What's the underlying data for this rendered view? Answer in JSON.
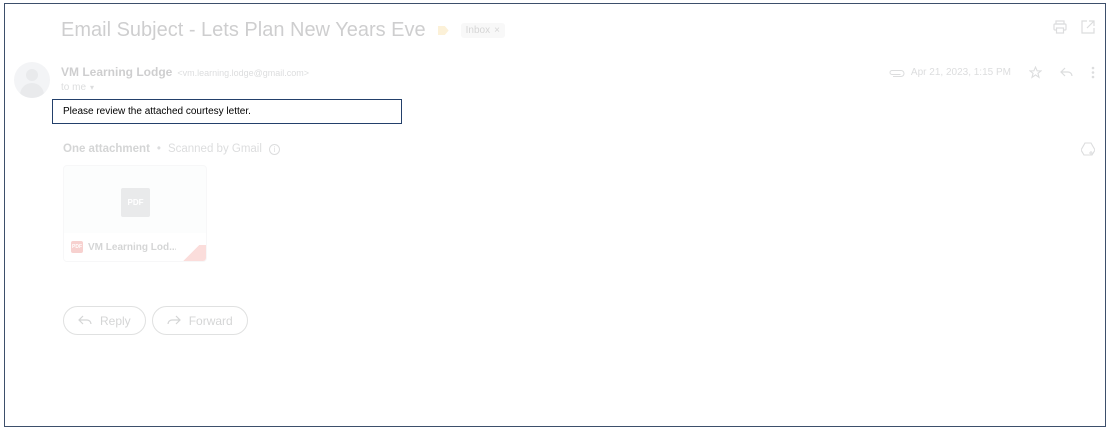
{
  "email": {
    "subject": "Email Subject - Lets Plan New Years Eve",
    "label_chip": "Inbox",
    "label_chip_close": "×",
    "sender_name": "VM Learning Lodge",
    "sender_email": "<vm.learning.lodge@gmail.com>",
    "to_line": "to me",
    "to_caret": "▾",
    "date": "Apr 21, 2023, 1:15 PM",
    "body": "Please review the attached courtesy letter."
  },
  "attachments": {
    "title": "One attachment",
    "separator": "•",
    "scanned_text": "Scanned by Gmail",
    "info_glyph": "i",
    "items": [
      {
        "big_icon_text": "PDF",
        "small_icon_text": "PDF",
        "file_name": "VM Learning Lod..."
      }
    ]
  },
  "actions": {
    "reply_label": "Reply",
    "forward_label": "Forward"
  },
  "colors": {
    "callout_border": "#23406b",
    "label_marker": "#f2c14e",
    "pdf_red": "#d93025"
  },
  "icons": [
    "print-icon",
    "open-in-new-window-icon",
    "label-icon",
    "attachment-clip-icon",
    "star-icon",
    "reply-icon",
    "more-vert-icon",
    "add-to-drive-icon",
    "info-icon",
    "pdf-icon",
    "forward-icon"
  ]
}
